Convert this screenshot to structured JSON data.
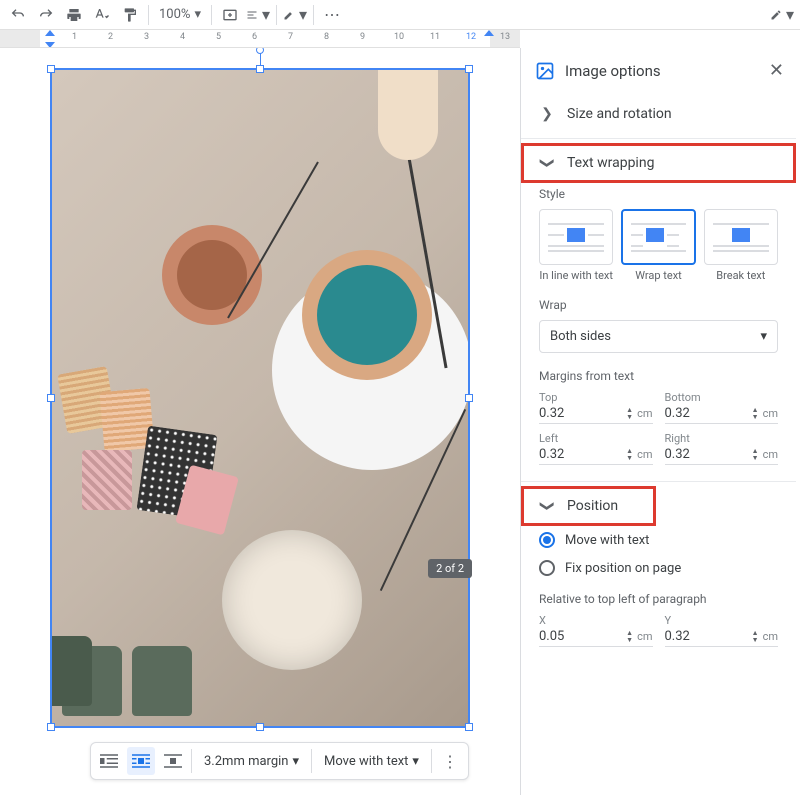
{
  "toolbar": {
    "zoom": "100%"
  },
  "ruler": {
    "numbers": [
      1,
      2,
      3,
      4,
      5,
      6,
      7,
      8,
      9,
      10,
      11,
      12,
      13
    ]
  },
  "image_toolbar": {
    "margin_label": "3.2mm margin",
    "move_label": "Move with text"
  },
  "match_badge": "2 of 2",
  "sidebar": {
    "title": "Image options",
    "sections": {
      "size": {
        "title": "Size and rotation"
      },
      "wrap": {
        "title": "Text wrapping",
        "style_label": "Style",
        "styles": [
          {
            "name": "In line with text"
          },
          {
            "name": "Wrap text"
          },
          {
            "name": "Break text"
          }
        ],
        "wrap_label": "Wrap",
        "wrap_value": "Both sides",
        "margins_label": "Margins from text",
        "margins": {
          "top": {
            "label": "Top",
            "value": "0.32",
            "unit": "cm"
          },
          "bottom": {
            "label": "Bottom",
            "value": "0.32",
            "unit": "cm"
          },
          "left": {
            "label": "Left",
            "value": "0.32",
            "unit": "cm"
          },
          "right": {
            "label": "Right",
            "value": "0.32",
            "unit": "cm"
          }
        }
      },
      "position": {
        "title": "Position",
        "options": [
          {
            "label": "Move with text",
            "selected": true
          },
          {
            "label": "Fix position on page",
            "selected": false
          }
        ],
        "relative_label": "Relative to top left of paragraph",
        "x": {
          "label": "X",
          "value": "0.05",
          "unit": "cm"
        },
        "y": {
          "label": "Y",
          "value": "0.32",
          "unit": "cm"
        }
      }
    }
  }
}
